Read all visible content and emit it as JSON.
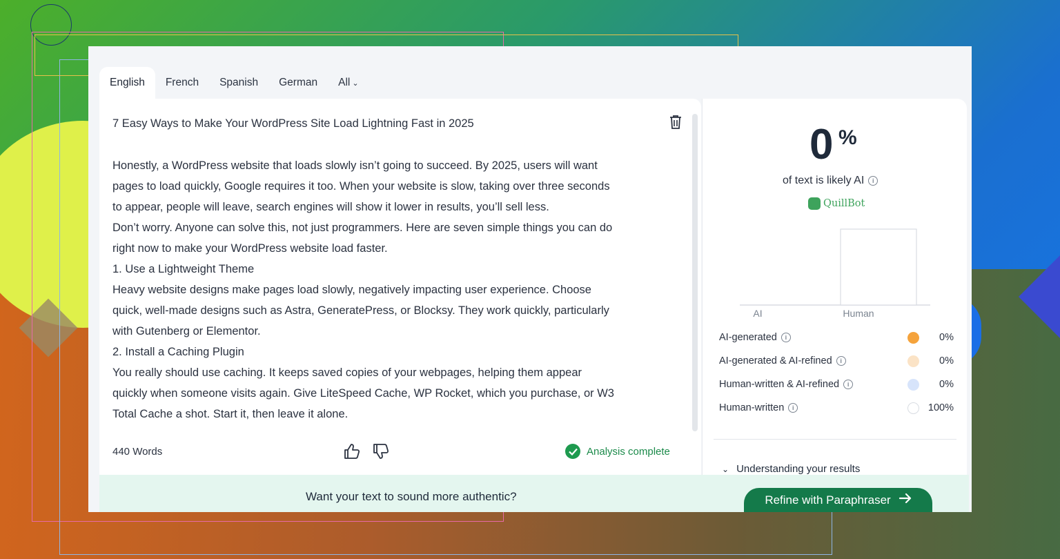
{
  "tabs": [
    {
      "label": "English",
      "active": true
    },
    {
      "label": "French"
    },
    {
      "label": "Spanish"
    },
    {
      "label": "German"
    },
    {
      "label": "All"
    }
  ],
  "editor": {
    "title": "7 Easy Ways to Make Your WordPress Site Load Lightning Fast in 2025",
    "lines": [
      "Honestly, a WordPress website that loads slowly isn’t going to succeed. By 2025, users will want",
      "pages to load quickly, Google requires it too. When your website is slow, taking over three seconds",
      "to appear, people will leave, search engines will show it lower in results, you’ll sell less.",
      "Don’t worry. Anyone can solve this, not just programmers. Here are seven simple things you can do",
      "right now to make your WordPress website load faster.",
      "1. Use a Lightweight Theme",
      "Heavy website designs make pages load slowly, negatively impacting user experience. Choose",
      "quick, well-made designs such as Astra, GeneratePress, or Blocksy. They work quickly, particularly",
      "with Gutenberg or Elementor.",
      "2. Install a Caching Plugin",
      "You really should use caching. It keeps saved copies of your webpages, helping them appear",
      "quickly when someone visits again. Give LiteSpeed Cache, WP Rocket, which you purchase, or W3",
      "Total Cache a shot. Start it, then leave it alone."
    ],
    "word_count": "440 Words",
    "status": "Analysis complete"
  },
  "results": {
    "percent": "0",
    "percent_sign": "%",
    "likely_label": "of text is likely AI",
    "brand": "QuillBot",
    "chart_labels": {
      "ai": "AI",
      "human": "Human"
    },
    "legend": [
      {
        "label": "AI-generated",
        "value": "0%",
        "color": "#f5a33c"
      },
      {
        "label": "AI-generated & AI-refined",
        "value": "0%",
        "color": "#fbe3c6"
      },
      {
        "label": "Human-written & AI-refined",
        "value": "0%",
        "color": "#d7e4fb"
      },
      {
        "label": "Human-written",
        "value": "100%",
        "color": "#ffffff"
      }
    ],
    "understanding": "Understanding your results"
  },
  "chart_data": {
    "type": "bar",
    "categories": [
      "AI",
      "Human"
    ],
    "values": [
      0,
      100
    ],
    "ylim": [
      0,
      100
    ]
  },
  "cta": {
    "prompt": "Want your text to sound more authentic?",
    "button": "Refine with Paraphraser"
  }
}
